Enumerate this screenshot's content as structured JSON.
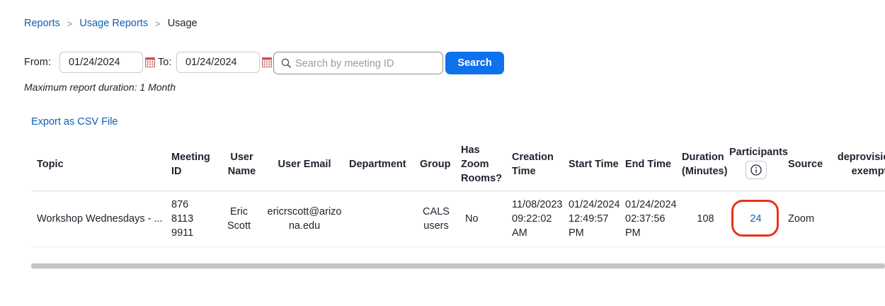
{
  "breadcrumb": {
    "items": [
      "Reports",
      "Usage Reports"
    ],
    "current": "Usage",
    "separator": ">"
  },
  "filters": {
    "from_label": "From:",
    "from_value": "01/24/2024",
    "to_label": "To:",
    "to_value": "01/24/2024",
    "search_placeholder": "Search by meeting ID",
    "search_button": "Search"
  },
  "note": "Maximum report duration: 1 Month",
  "export_label": "Export as CSV File",
  "table": {
    "headers": {
      "topic": "Topic",
      "meeting_id": "Meeting ID",
      "user_name": "User Name",
      "user_email": "User Email",
      "department": "Department",
      "group": "Group",
      "has_zoom_rooms": "Has Zoom Rooms?",
      "creation_time": "Creation Time",
      "start_time": "Start Time",
      "end_time": "End Time",
      "duration": "Duration (Minutes)",
      "participants": "Participants",
      "source": "Source",
      "deprovision": "deprovision_exempt"
    },
    "rows": [
      {
        "topic": "Workshop Wednesdays - ...",
        "meeting_id": "876 8113 9911",
        "user_name": "Eric Scott",
        "user_email": "ericrscott@arizona.edu",
        "department": "",
        "group": "CALS users",
        "has_zoom_rooms": "No",
        "creation_time": "11/08/2023 09:22:02 AM",
        "start_time": "01/24/2024 12:49:57 PM",
        "end_time": "01/24/2024 02:37:56 PM",
        "duration": "108",
        "participants": "24",
        "source": "Zoom",
        "deprovision": ""
      }
    ]
  },
  "colors": {
    "link": "#0e5fb3",
    "primary_button": "#0e72ed",
    "highlight": "#e8321e"
  },
  "icons": [
    "calendar-icon",
    "search-icon",
    "info-icon"
  ]
}
